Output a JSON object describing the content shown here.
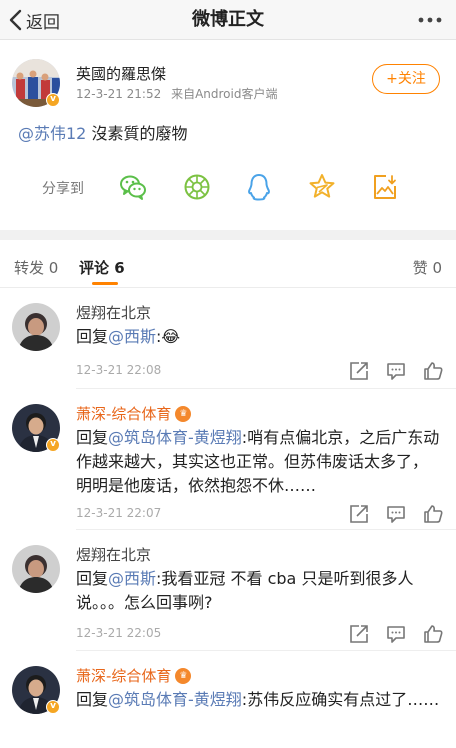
{
  "nav": {
    "back_label": "返回",
    "title": "微博正文"
  },
  "post": {
    "author": "英國的羅思傑",
    "time": "12-3-21 21:52",
    "source": "来自Android客户端",
    "follow_label": "+关注",
    "mention": "@苏伟12",
    "text": " 沒素質的廢物",
    "share_label": "分享到",
    "share_icons": [
      "wechat-icon",
      "moments-icon",
      "qq-icon",
      "qzone-star-icon",
      "save-image-icon"
    ]
  },
  "tabs": {
    "repost": "转发 0",
    "comments": "评论 6",
    "likes": "赞 0"
  },
  "comments": [
    {
      "name": "煜翔在北京",
      "reply_prefix": "回复",
      "mention": "@西斯",
      "text": ":😂",
      "time": "12-3-21 22:08"
    },
    {
      "name": "萧深-综合体育",
      "reply_prefix": "回复",
      "mention": "@筑岛体育-黄煜翔",
      "text": ":哨有点偏北京，之后广东动作越来越大，其实这也正常。但苏伟废话太多了，明明是他废话，依然抱怨不休……",
      "time": "12-3-21 22:07"
    },
    {
      "name": "煜翔在北京",
      "reply_prefix": "回复",
      "mention": "@西斯",
      "text": ":我看亚冠 不看 cba 只是听到很多人说。。。怎么回事咧?",
      "time": "12-3-21 22:05"
    },
    {
      "name": "萧深-综合体育",
      "reply_prefix": "回复",
      "mention": "@筑岛体育-黄煜翔",
      "text": ":苏伟反应确实有点过了……",
      "time": ""
    }
  ],
  "colors": {
    "accent": "#ff8200",
    "mention": "#5a7bb5",
    "vip_name": "#e8661a"
  }
}
